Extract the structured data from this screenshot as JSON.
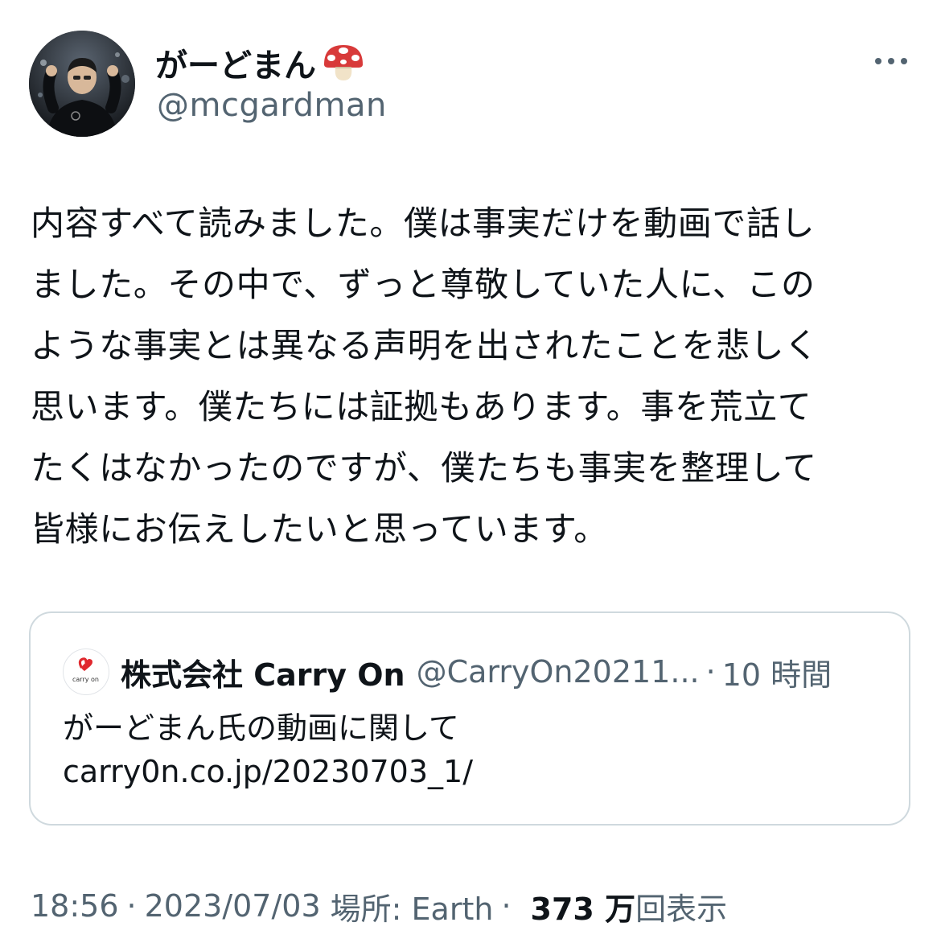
{
  "author": {
    "display_name": "がーどまん",
    "name_emoji": "mushroom-icon",
    "handle": "@mcgardman"
  },
  "tweet": {
    "lines": [
      "内容すべて読みました。僕は事実だけを動画で話し",
      "ました。その中で、ずっと尊敬していた人に、この",
      "ような事実とは異なる声明を出されたことを悲しく",
      "思います。僕たちには証拠もあります。事を荒立て",
      "たくはなかったのですが、僕たちも事実を整理して",
      "皆様にお伝えしたいと思っています。"
    ]
  },
  "quote": {
    "avatar_text": "carry on",
    "name": "株式会社 Carry On",
    "handle": "@CarryOn20211...",
    "separator": "·",
    "time": "10 時間",
    "text_lines": [
      "がーどまん氏の動画に関して",
      "carry0n.co.jp/20230703_1/"
    ]
  },
  "meta": {
    "time": "18:56",
    "dot1": "·",
    "date": "2023/07/03",
    "location": "場所: Earth",
    "dot2": "·",
    "views_count": "373 万",
    "views_label": "回表示"
  },
  "colors": {
    "text_primary": "#0f1419",
    "text_secondary": "#536471",
    "border": "#cfd9de",
    "brand_red": "#e0282e"
  }
}
